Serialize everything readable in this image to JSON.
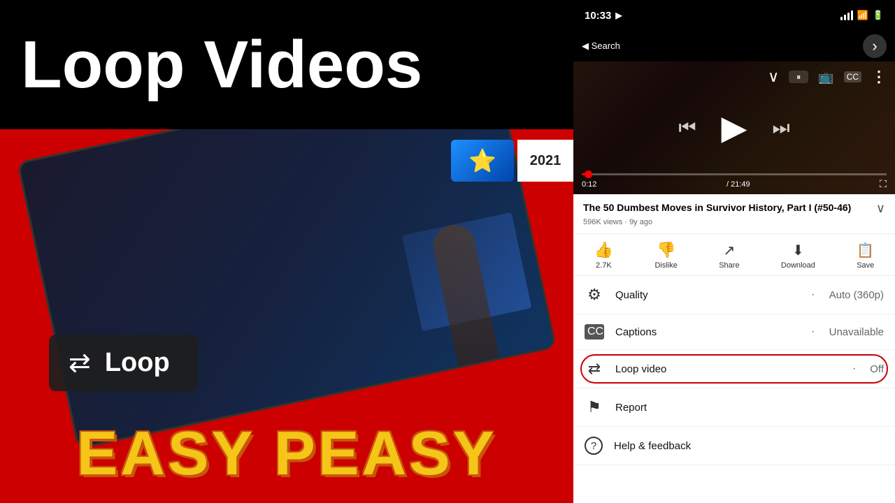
{
  "left": {
    "title": "Loop Videos",
    "easy_peasy": "EASY PEASY",
    "loop_button_text": "Loop"
  },
  "right": {
    "status_bar": {
      "time": "10:33",
      "location_icon": "▶",
      "back_label": "◀ Search"
    },
    "nav": {
      "forward_icon": "›"
    },
    "video": {
      "time_current": "0:12",
      "time_total": "21:49",
      "title": "The 50 Dumbest Moves in Survivor History, Part I (#50-46)",
      "views": "596K views",
      "ago": "9y ago"
    },
    "actions": [
      {
        "icon": "👍",
        "label": "2.7K",
        "name": "like"
      },
      {
        "icon": "👎",
        "label": "Dislike",
        "name": "dislike"
      },
      {
        "icon": "↗",
        "label": "Share",
        "name": "share"
      },
      {
        "icon": "⬇",
        "label": "Download",
        "name": "download"
      },
      {
        "icon": "≡+",
        "label": "Save",
        "name": "save"
      }
    ],
    "menu": [
      {
        "icon": "⚙",
        "label": "Quality",
        "value": "Auto (360p)",
        "name": "quality"
      },
      {
        "icon": "cc",
        "label": "Captions",
        "value": "Unavailable",
        "name": "captions"
      },
      {
        "icon": "↺",
        "label": "Loop video",
        "value": "Off",
        "name": "loop-video"
      },
      {
        "icon": "⚑",
        "label": "Report",
        "value": "",
        "name": "report"
      },
      {
        "icon": "?",
        "label": "Help & feedback",
        "value": "",
        "name": "help-feedback"
      }
    ]
  },
  "colors": {
    "red": "#cc0000",
    "yellow": "#f5c518",
    "dark": "#111111",
    "white": "#ffffff"
  }
}
